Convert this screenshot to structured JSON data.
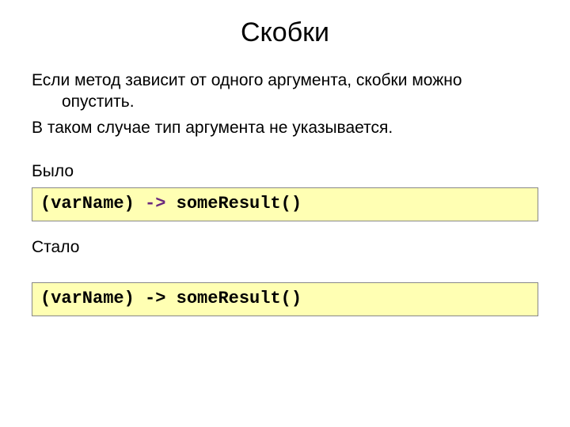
{
  "title": "Скобки",
  "paragraphs": {
    "p1": "Если метод зависит от одного аргумента, скобки можно опустить.",
    "p2": "В таком случае тип аргумента не указывается.",
    "label_before": "Было",
    "label_after": "Стало"
  },
  "code": {
    "before": {
      "t1": "(varName)",
      "t2": " -> ",
      "t3": "someResult()"
    },
    "after": {
      "t1": "(varName)",
      "t2": " -> ",
      "t3": "someResult()"
    }
  }
}
